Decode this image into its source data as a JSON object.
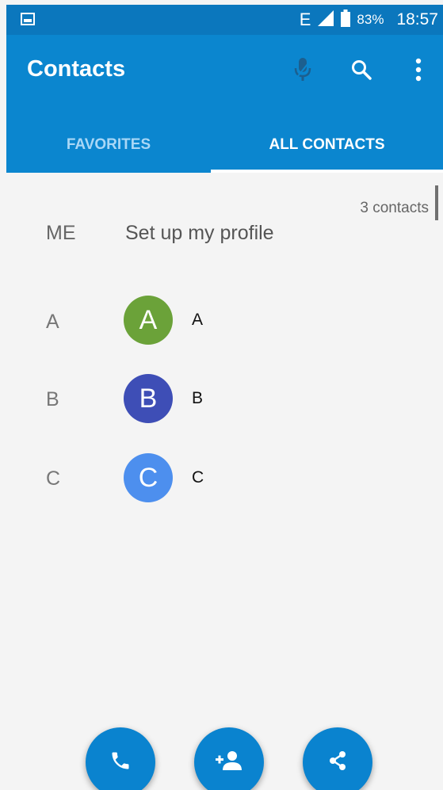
{
  "status_bar": {
    "network": "E",
    "battery_percent": "83%",
    "time": "18:57",
    "icons": [
      "gallery-icon",
      "signal-icon",
      "battery-icon"
    ]
  },
  "app_bar": {
    "title": "Contacts",
    "icons": [
      "mic-icon",
      "search-icon",
      "more-vert-icon"
    ]
  },
  "tabs": [
    {
      "label": "FAVORITES",
      "selected": false
    },
    {
      "label": "ALL CONTACTS",
      "selected": true
    }
  ],
  "contacts": {
    "count_label": "3 contacts",
    "me": {
      "label": "ME",
      "text": "Set up my profile"
    },
    "items": [
      {
        "section": "A",
        "initial": "A",
        "name": "A",
        "color": "#6ba239"
      },
      {
        "section": "B",
        "initial": "B",
        "name": "B",
        "color": "#3e4eb6"
      },
      {
        "section": "C",
        "initial": "C",
        "name": "C",
        "color": "#4d8fee"
      }
    ]
  },
  "fabs": [
    "dial-icon",
    "add-contact-icon",
    "share-icon"
  ],
  "colors": {
    "status_bar": "#0b77bd",
    "primary": "#0b86cf",
    "tab_inactive": "#a9d7f6",
    "fab": "#0a83cf"
  }
}
